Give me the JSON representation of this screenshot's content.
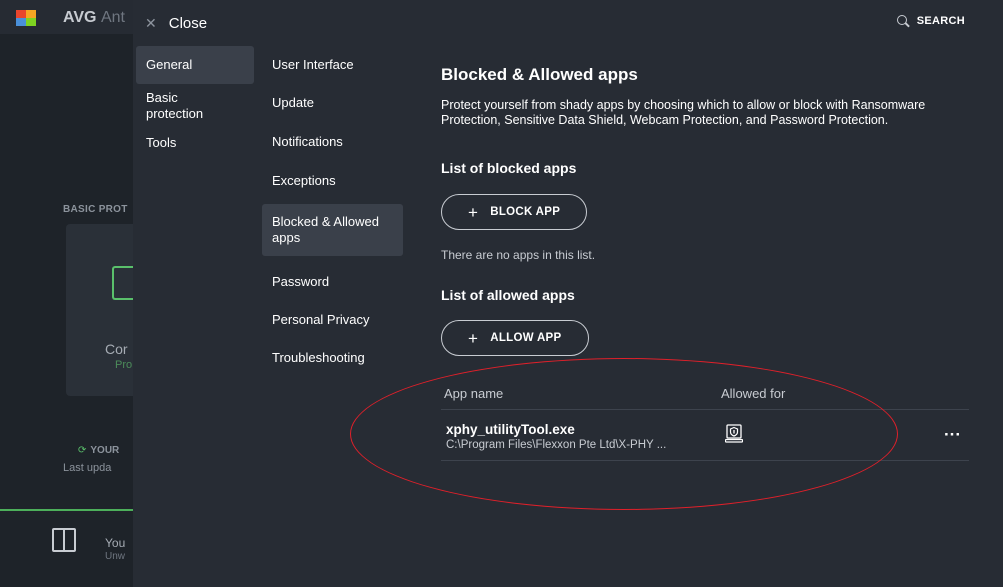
{
  "background_app": {
    "brand": "AVG",
    "brand_truncated": "Ant",
    "section_label": "BASIC PROT",
    "card_text": "Cor",
    "card_subtext": "Pro",
    "status_label": "YOUR",
    "update_label": "Last upda",
    "promo_title": "You",
    "promo_subtitle": "Unw"
  },
  "topbar": {
    "close_label": "Close",
    "search_label": "SEARCH"
  },
  "categories": [
    {
      "label": "General",
      "active": true
    },
    {
      "label": "Basic protection",
      "active": false
    },
    {
      "label": "Tools",
      "active": false
    }
  ],
  "subnav": [
    {
      "label": "User Interface",
      "active": false
    },
    {
      "label": "Update",
      "active": false
    },
    {
      "label": "Notifications",
      "active": false
    },
    {
      "label": "Exceptions",
      "active": false
    },
    {
      "label": "Blocked & Allowed apps",
      "active": true
    },
    {
      "label": "Password",
      "active": false
    },
    {
      "label": "Personal Privacy",
      "active": false
    },
    {
      "label": "Troubleshooting",
      "active": false
    }
  ],
  "content": {
    "title": "Blocked & Allowed apps",
    "description": "Protect yourself from shady apps by choosing which to allow or block with Ransomware Protection, Sensitive Data Shield, Webcam Protection, and Password Protection.",
    "blocked_heading": "List of blocked apps",
    "block_button": "BLOCK APP",
    "blocked_empty": "There are no apps in this list.",
    "allowed_heading": "List of allowed apps",
    "allow_button": "ALLOW APP",
    "table_headers": {
      "app_name": "App name",
      "allowed_for": "Allowed for"
    },
    "allowed_apps": [
      {
        "name": "xphy_utilityTool.exe",
        "path": "C:\\Program Files\\Flexxon Pte Ltd\\X-PHY ...",
        "permission_icon": "laptop-shield-icon"
      }
    ]
  },
  "colors": {
    "overlay_bg": "#272c34",
    "active_item_bg": "#3a404a",
    "annotation": "#e0202a",
    "accent_green": "#5ac06b"
  }
}
